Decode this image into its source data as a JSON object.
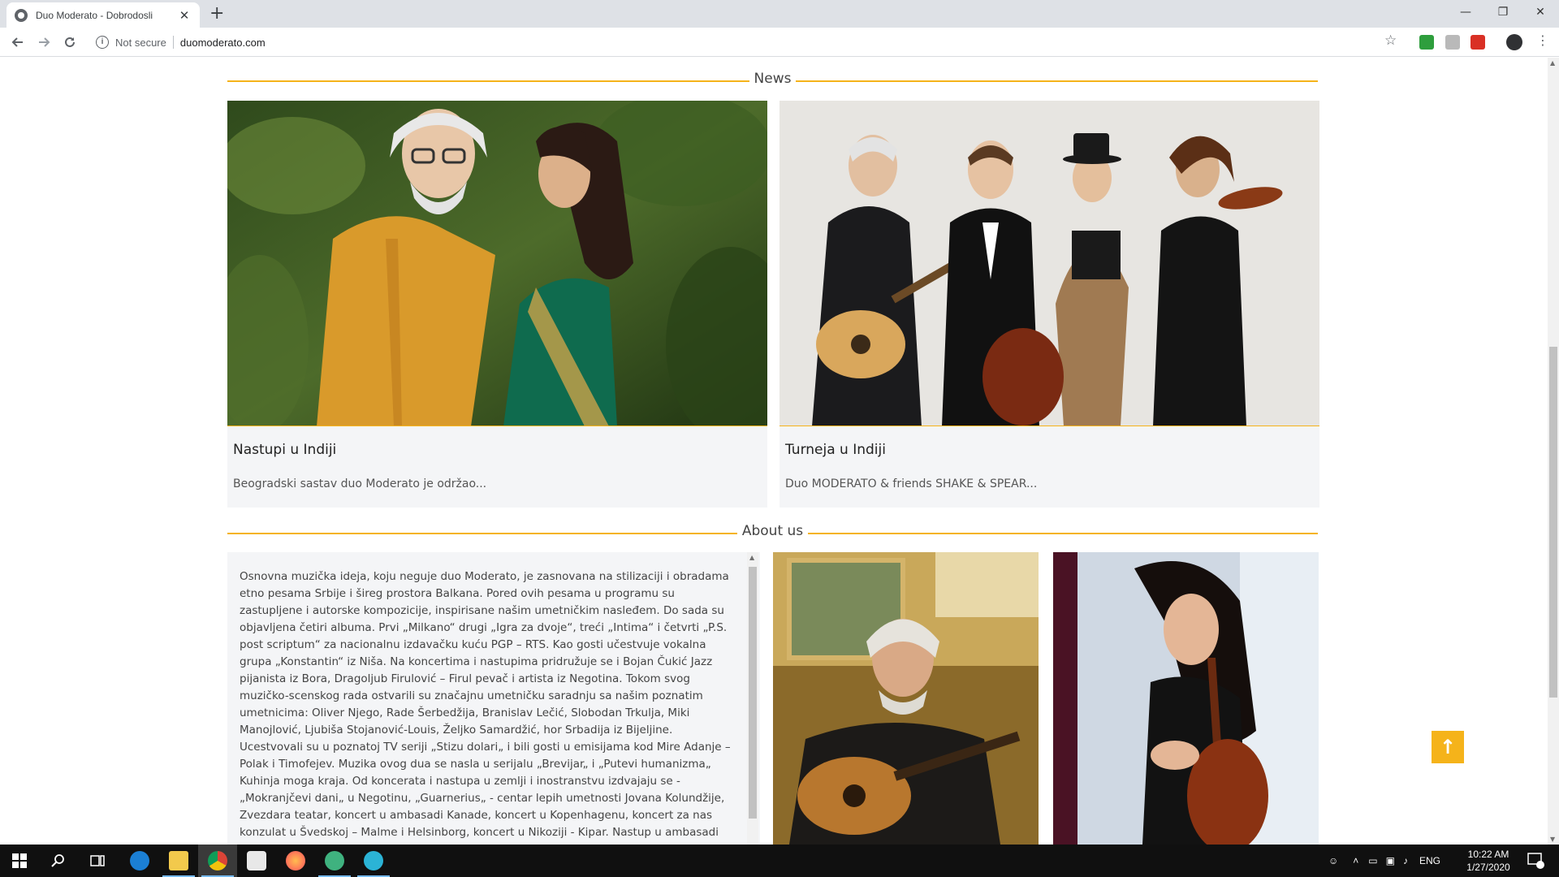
{
  "browser": {
    "tab_title": "Duo Moderato - Dobrodosli",
    "tab_close": "✕",
    "new_tab": "+",
    "security_text": "Not secure",
    "url": "duomoderato.com",
    "window_controls": [
      "—",
      "❐",
      "✕"
    ]
  },
  "page": {
    "news_title": "News",
    "news_cards": [
      {
        "title": "Nastupi u  Indiji",
        "excerpt": "Beogradski sastav duo  Moderato je održao..."
      },
      {
        "title": "Turneja u  Indiji",
        "excerpt": "Duo  MODERATO & friends SHAKE & SPEAR..."
      }
    ],
    "about_title": "About us",
    "about_text": "Osnovna muzička ideja, koju neguje duo  Moderato, je zasnovana na stilizaciji i obradama etno pesama Srbije i šireg prostora  Balkana.  Pored ovih pesama u programu su zastupljene i autorske kompozicije, inspirisane našim umetničkim nasleđem.  Do sada su objavljena četiri albuma.  Prvi „Milkano“ drugi „Igra za dvoje“, treći „Intima“ i četvrti „P.S. post scriptum“ za nacionalnu izdavačku kuću  PGP –  RTS.  Kao gosti učestvuje vokalna grupa „Konstantin“ iz  Niša.  Na koncertima i nastupima pridružuje se i  Bojan Čukić Jazz pijanista iz  Bora,  Dragoljub  Firulović –  Firul pevač i artista iz  Negotina. Tokom svog muzičko-scenskog rada ostvarili su značajnu umetničku saradnju sa našim poznatim umetnicima: Oliver  Njego,  Rade Šerbedžija,  Branislav  Lečić, Slobodan Trkulja,  Miki Manojlović,  Ljubiša Stojanović-Louis, Željko Samardžić, hor Srbadija iz  Bijeljine.  Ucestvovali su u poznatoj TV seriji „Stizu dolari„ i bili gosti u emisijama kod  Mire Adanje – Polak i Timofejev.  Muzika ovog dua se nasla u serijalu „Brevijar„ i „Putevi humanizma„ Kuhinja moga kraja. Od koncerata i nastupa u zemlji i inostranstvu izdvajaju se - „Mokranjčevi dani„ u  Negotinu,  „Guarnerius„ - centar lepih umetnosti Jovana  Kolundžije, Zvezdara teatar, koncert u ambasadi  Kanade, koncert u  Kopenhagenu, koncert za nas konzulat u Švedskoj –  Malme i  Helsinborg, koncert u  Nikoziji -  Kipar.  Nastup u ambasadi",
    "back_to_top": "↑"
  },
  "taskbar": {
    "lang": "ENG",
    "time": "10:22 AM",
    "date": "1/27/2020"
  },
  "colors": {
    "accent": "#f5b31a",
    "card_bg": "#f4f5f7",
    "taskbar": "#101010"
  }
}
